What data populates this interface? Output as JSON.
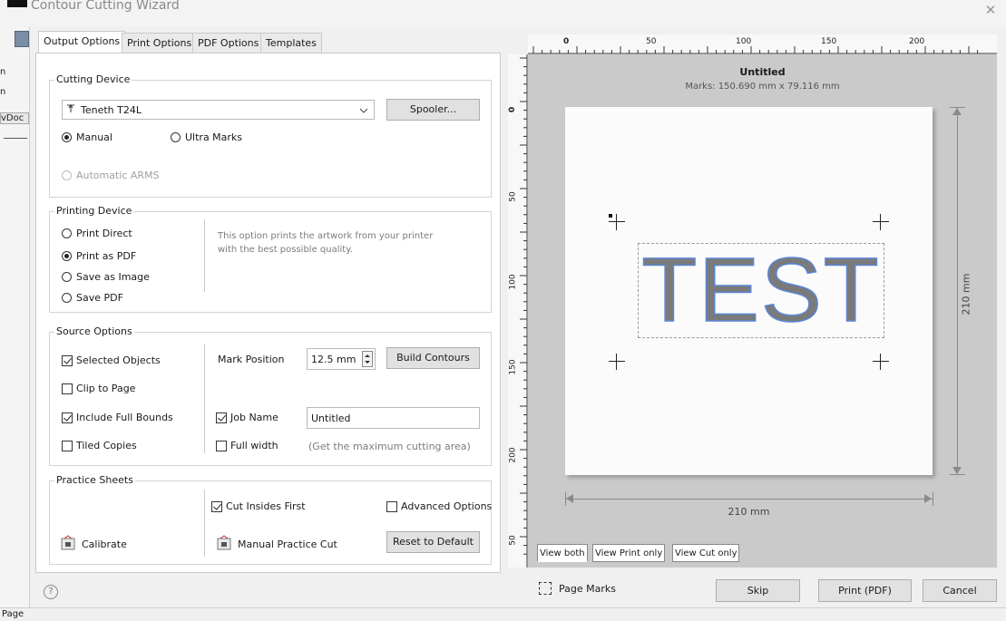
{
  "window": {
    "title": "Contour Cutting Wizard",
    "close_glyph": "✕"
  },
  "background_app": {
    "items": [
      "n",
      "n",
      "vDoc"
    ],
    "status_label": "Page"
  },
  "tabs": [
    {
      "label": "Output Options",
      "active": true
    },
    {
      "label": "Print Options",
      "active": false
    },
    {
      "label": "PDF Options",
      "active": false
    },
    {
      "label": "Templates",
      "active": false
    }
  ],
  "cutting_device": {
    "group_label": "Cutting Device",
    "device_value": "Teneth T24L",
    "spooler_label": "Spooler...",
    "manual_label": "Manual",
    "ultra_marks_label": "Ultra Marks",
    "automatic_arms_label": "Automatic ARMS",
    "selected": "Manual"
  },
  "printing_device": {
    "group_label": "Printing Device",
    "options": [
      {
        "label": "Print Direct",
        "selected": false
      },
      {
        "label": "Print as PDF",
        "selected": true
      },
      {
        "label": "Save as Image",
        "selected": false
      },
      {
        "label": "Save PDF",
        "selected": false
      }
    ],
    "description": "This option prints the artwork from your printer with the best possible quality."
  },
  "source_options": {
    "group_label": "Source Options",
    "selected_objects_label": "Selected Objects",
    "selected_objects_checked": true,
    "clip_to_page_label": "Clip to Page",
    "clip_to_page_checked": false,
    "include_full_bounds_label": "Include Full Bounds",
    "include_full_bounds_checked": true,
    "tiled_copies_label": "Tiled Copies",
    "tiled_copies_checked": false,
    "mark_position_label": "Mark Position",
    "mark_position_value": "12.5 mm",
    "build_contours_label": "Build Contours",
    "job_name_label": "Job Name",
    "job_name_checked": true,
    "job_name_value": "Untitled",
    "full_width_label": "Full width",
    "full_width_checked": false,
    "full_width_hint": "(Get the maximum cutting area)"
  },
  "practice_sheets": {
    "group_label": "Practice Sheets",
    "cut_insides_first_label": "Cut Insides First",
    "cut_insides_first_checked": true,
    "advanced_options_label": "Advanced Options",
    "advanced_options_checked": false,
    "calibrate_label": "Calibrate",
    "manual_practice_cut_label": "Manual Practice Cut",
    "reset_label": "Reset to Default"
  },
  "help_glyph": "?",
  "preview": {
    "doc_title": "Untitled",
    "marks_info": "Marks: 150.690 mm x 79.116 mm",
    "artwork_text": "TEST",
    "width_label": "210 mm",
    "height_label": "210 mm",
    "ruler_top_labels": [
      "0",
      "50",
      "100",
      "150",
      "200"
    ],
    "ruler_left_labels": [
      "0",
      "50",
      "100",
      "150",
      "200",
      "50"
    ],
    "view_tabs": [
      {
        "label": "View both",
        "active": true
      },
      {
        "label": "View Print only",
        "active": false
      },
      {
        "label": "View Cut only",
        "active": false
      }
    ]
  },
  "footer": {
    "page_marks_label": "Page Marks",
    "skip_label": "Skip",
    "print_label": "Print (PDF)",
    "cancel_label": "Cancel"
  }
}
